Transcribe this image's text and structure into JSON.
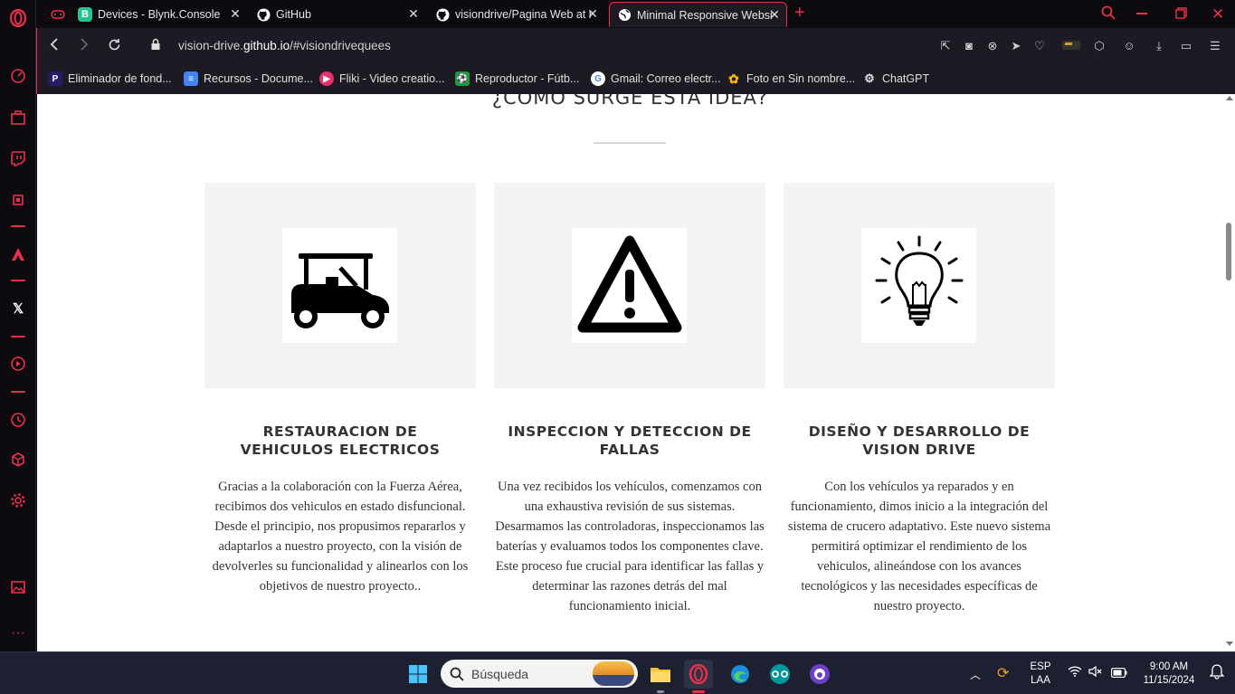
{
  "browser": {
    "tabs": [
      {
        "label": "",
        "icon": "gamepad-icon"
      },
      {
        "label": "Devices - Blynk.Console",
        "icon": "blynk-icon"
      },
      {
        "label": "GitHub",
        "icon": "github-icon"
      },
      {
        "label": "visiondrive/Pagina Web at main",
        "icon": "github-icon"
      },
      {
        "label": "Minimal Responsive Website",
        "icon": "globe-icon",
        "active": true
      }
    ],
    "new_tab_label": "+",
    "url_prefix": "vision-drive.",
    "url_domain": "github.io",
    "url_suffix": "/#visiondrivequees",
    "bookmarks": [
      {
        "label": "Eliminador de fond...",
        "icon_text": "P",
        "color": "#3a1aa8"
      },
      {
        "label": "Recursos - Docume...",
        "icon_text": "≡",
        "color": "#4285f4"
      },
      {
        "label": "Fliki - Video creatio...",
        "icon_text": "▶",
        "color": "#e8306a"
      },
      {
        "label": "Reproductor - Fútb...",
        "icon_text": "⚽",
        "color": "#1a9a40"
      },
      {
        "label": "Gmail: Correo electr...",
        "icon_text": "G",
        "color": "#ffffff"
      },
      {
        "label": "Foto en Sin nombre...",
        "icon_text": "✿",
        "color": "#f4b400"
      },
      {
        "label": "ChatGPT",
        "icon_text": "⚙",
        "color": "#333333"
      }
    ]
  },
  "page": {
    "section_title": "¿COMO SURGE ESTA IDEA?",
    "cards": [
      {
        "icon": "golf-cart-icon",
        "title": "RESTAURACION DE VEHICULOS ELECTRICOS",
        "text": "Gracias a la colaboración con la Fuerza Aérea, recibimos dos vehiculos en estado disfuncional. Desde el principio, nos propusimos repararlos y adaptarlos a nuestro proyecto, con la visión de devolverles su funcionalidad y alinearlos con los objetivos de nuestro proyecto.."
      },
      {
        "icon": "warning-icon",
        "title": "INSPECCION Y DETECCION DE FALLAS",
        "text": "Una vez recibidos los vehículos, comenzamos con una exhaustiva revisión de sus sistemas. Desarmamos las controladoras, inspeccionamos las baterías y evaluamos todos los componentes clave. Este proceso fue crucial para identificar las fallas y determinar las razones detrás del mal funcionamiento inicial."
      },
      {
        "icon": "lightbulb-icon",
        "title": "DISEÑO Y DESARROLLO DE VISION DRIVE",
        "text": "Con los vehículos ya reparados y en funcionamiento, dimos inicio a la integración del sistema de crucero adaptativo. Este nuevo sistema permitirá optimizar el rendimiento de los vehiculos, alineándose con los avances tecnológicos y las necesidades específicas de nuestro proyecto."
      }
    ]
  },
  "taskbar": {
    "search_placeholder": "Búsqueda",
    "language": "ESP",
    "layout": "LAA",
    "time": "9:00 AM",
    "date": "11/15/2024"
  },
  "colors": {
    "accent": "#e8304a",
    "browser_bg": "#1e1a24",
    "taskbar_bg": "#1c2030"
  }
}
